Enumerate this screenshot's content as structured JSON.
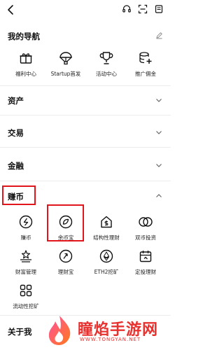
{
  "nav_sections": {
    "my_nav": {
      "title": "我的导航",
      "items": [
        {
          "label": "福利中心",
          "icon": "gift-icon"
        },
        {
          "label": "Startup首发",
          "icon": "parachute-icon"
        },
        {
          "label": "活动中心",
          "icon": "trophy-icon"
        },
        {
          "label": "推广佣金",
          "icon": "coins-plus-icon"
        }
      ]
    },
    "assets": {
      "title": "资产"
    },
    "trade": {
      "title": "交易"
    },
    "finance": {
      "title": "金融"
    },
    "earn": {
      "title": "赚币",
      "items": [
        {
          "label": "赚币",
          "icon": "earn-coin-icon"
        },
        {
          "label": "余币宝",
          "icon": "savings-icon"
        },
        {
          "label": "结构性理财",
          "icon": "structured-product-icon"
        },
        {
          "label": "双币投资",
          "icon": "dual-currency-icon"
        },
        {
          "label": "财富管理",
          "icon": "wealth-icon"
        },
        {
          "label": "理财宝",
          "icon": "wallet-icon"
        },
        {
          "label": "ETH2挖矿",
          "icon": "eth-icon"
        },
        {
          "label": "定投理财",
          "icon": "calendar-icon"
        },
        {
          "label": "流动性挖矿",
          "icon": "liquidity-icon"
        }
      ]
    },
    "about": {
      "title": "关于我"
    }
  },
  "watermark": {
    "text": "瞳焰手游网",
    "url": "WWW.TONGYAN.NET"
  },
  "colors": {
    "highlight": "#e0161c",
    "watermark": "#e8322f"
  }
}
